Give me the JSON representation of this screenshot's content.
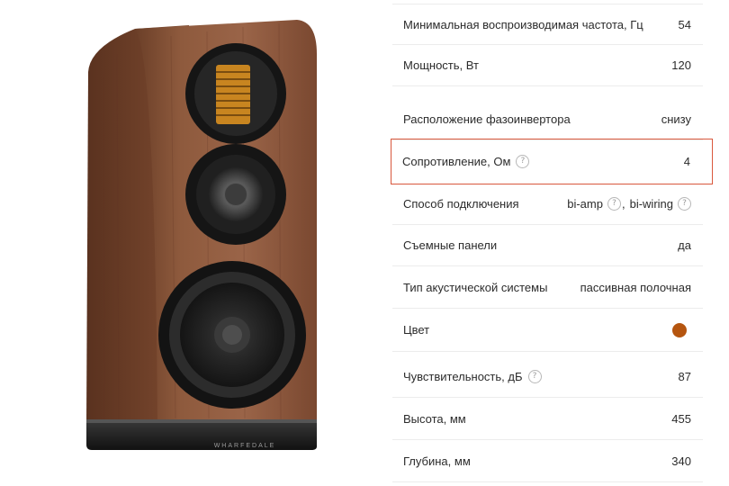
{
  "product": {
    "brand_logo_text": "WHARFEDALE"
  },
  "specs": [
    {
      "label": "Минимальная воспроизводимая частота, Гц",
      "value": "54"
    },
    {
      "label": "Мощность, Вт",
      "value": "120"
    },
    {
      "label": "Расположение фазоинвертора",
      "value": "снизу"
    },
    {
      "label": "Сопротивление, Ом",
      "value": "4"
    },
    {
      "label": "Способ подключения",
      "value_part1": "bi-amp",
      "separator": ",",
      "value_part2": "bi-wiring"
    },
    {
      "label": "Съемные панели",
      "value": "да"
    },
    {
      "label": "Тип акустической системы",
      "value": "пассивная полочная"
    },
    {
      "label": "Цвет",
      "color": "#b5550f"
    },
    {
      "label": "Чувствительность, дБ",
      "value": "87"
    },
    {
      "label": "Высота, мм",
      "value": "455"
    },
    {
      "label": "Глубина, мм",
      "value": "340"
    }
  ],
  "help_icon_glyph": "?",
  "colors": {
    "highlight_border": "#d9583c",
    "walnut": "#8a5538",
    "swatch": "#b5550f"
  }
}
